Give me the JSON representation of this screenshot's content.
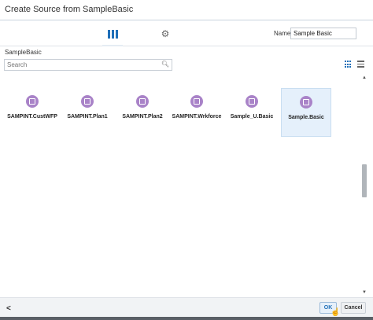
{
  "dialog": {
    "title": "Create Source from SampleBasic"
  },
  "toolbar": {
    "columns_icon": "columns-icon",
    "settings_icon": "gear-icon",
    "name_label": "Name",
    "name_value": "Sample Basic"
  },
  "section": {
    "label": "SampleBasic"
  },
  "search": {
    "placeholder": "Search",
    "icon": "search-icon"
  },
  "view_toggles": [
    {
      "name": "grid-view-icon",
      "active": true
    },
    {
      "name": "list-view-icon",
      "active": false
    }
  ],
  "tiles": [
    {
      "label": "SAMPINT.CustWFP",
      "selected": false
    },
    {
      "label": "SAMPINT.Plan1",
      "selected": false
    },
    {
      "label": "SAMPINT.Plan2",
      "selected": false
    },
    {
      "label": "SAMPINT.Wrkforce",
      "selected": false
    },
    {
      "label": "Sample_U.Basic",
      "selected": false
    },
    {
      "label": "Sample.Basic",
      "selected": true
    }
  ],
  "footer": {
    "back_icon": "chevron-left-icon",
    "ok_label": "OK",
    "cancel_label": "Cancel"
  },
  "colors": {
    "accent": "#1f6fb8",
    "tile_icon": "#a983c8",
    "selected_bg": "#e5f0fb"
  }
}
